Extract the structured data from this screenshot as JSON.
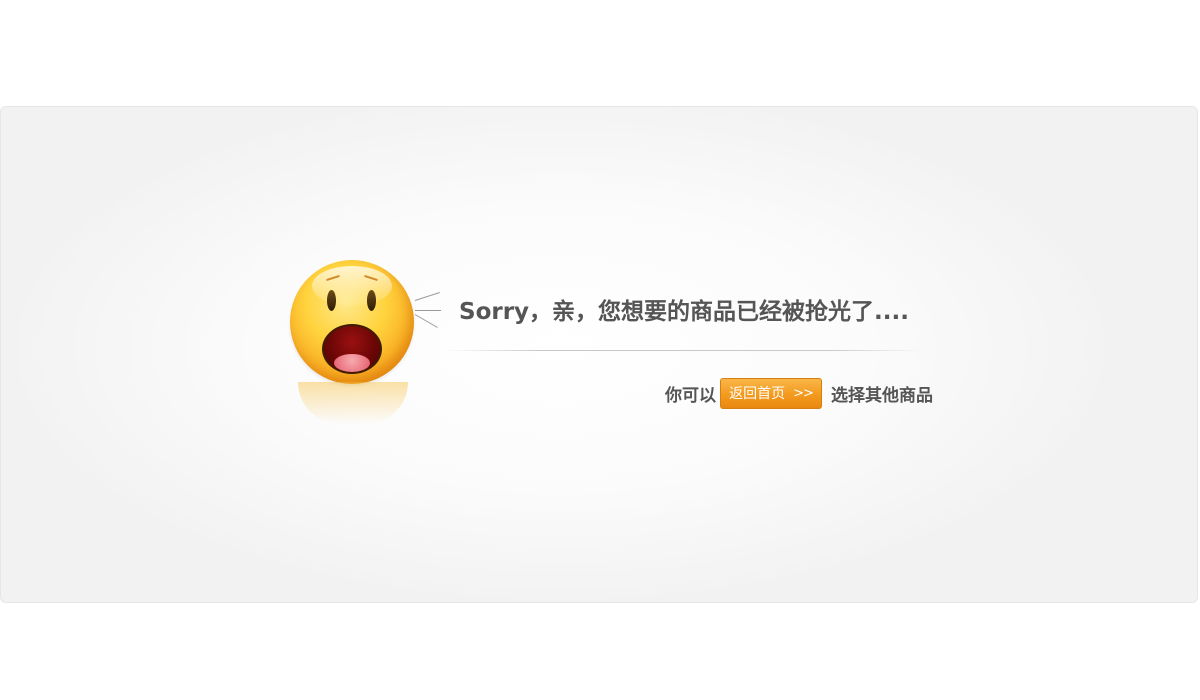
{
  "message": {
    "title": "Sorry，亲，您想要的商品已经被抢光了....",
    "hint_before": "你可以",
    "button_label": "返回首页",
    "button_arrow": ">>",
    "hint_after": "选择其他商品"
  },
  "colors": {
    "accent": "#f39a1e",
    "text": "#555555",
    "border": "#e6e6e6"
  },
  "icons": {
    "mascot": "shocked-emoji-icon",
    "exclaim": "exclamation-lines-icon"
  }
}
